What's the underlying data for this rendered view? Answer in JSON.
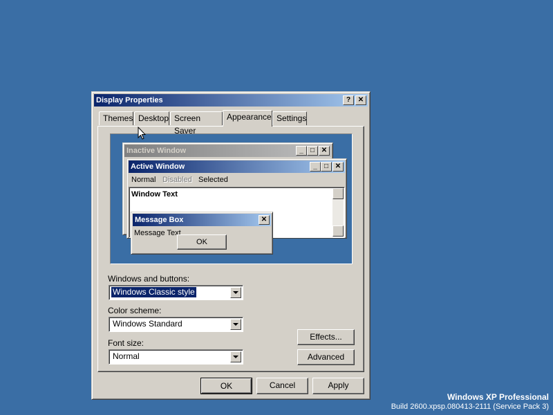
{
  "dialog": {
    "title": "Display Properties",
    "help_glyph": "?",
    "close_glyph": "✕"
  },
  "tabs": [
    {
      "label": "Themes"
    },
    {
      "label": "Desktop"
    },
    {
      "label": "Screen Saver"
    },
    {
      "label": "Appearance",
      "selected": true
    },
    {
      "label": "Settings"
    }
  ],
  "preview": {
    "inactive_title": "Inactive Window",
    "active_title": "Active Window",
    "menu_normal": "Normal",
    "menu_disabled": "Disabled",
    "menu_selected": "Selected",
    "window_text": "Window Text",
    "msgbox_title": "Message Box",
    "msgbox_text": "Message Text",
    "msgbox_ok": "OK"
  },
  "fields": {
    "windows_buttons_label": "Windows and buttons:",
    "windows_buttons_value": "Windows Classic style",
    "color_scheme_label": "Color scheme:",
    "color_scheme_value": "Windows Standard",
    "font_size_label": "Font size:",
    "font_size_value": "Normal"
  },
  "buttons": {
    "effects": "Effects...",
    "advanced": "Advanced",
    "ok": "OK",
    "cancel": "Cancel",
    "apply": "Apply"
  },
  "watermark": {
    "line1": "Windows XP Professional",
    "line2": "Build 2600.xpsp.080413-2111 (Service Pack 3)"
  },
  "colors": {
    "desktop": "#3a6ea5",
    "active_title": "#0a246a",
    "face": "#d4d0c8"
  }
}
